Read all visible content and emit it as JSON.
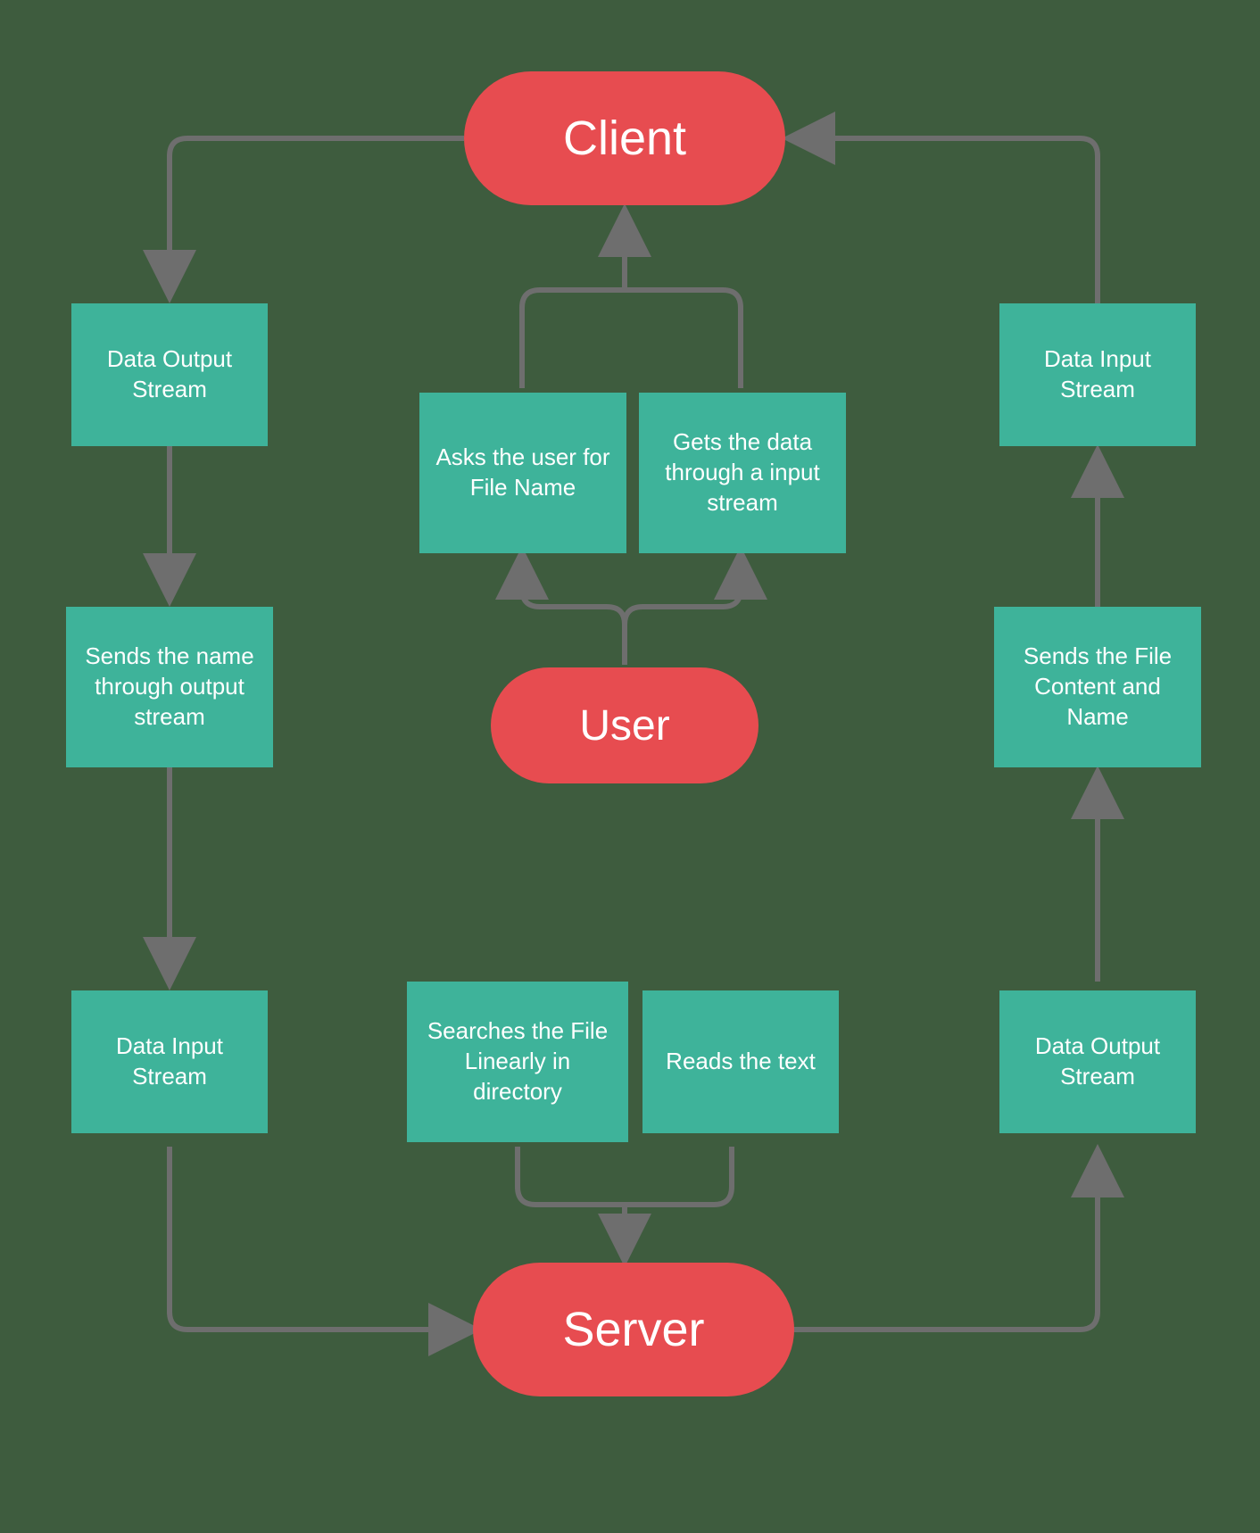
{
  "nodes": {
    "client": "Client",
    "user": "User",
    "server": "Server",
    "data_output_stream_left": "Data Output Stream",
    "sends_name": "Sends the name through output stream",
    "data_input_stream_left": "Data Input Stream",
    "asks_file_name": "Asks the user for File Name",
    "gets_data_input_stream": "Gets the data through a input stream",
    "searches_file": "Searches the File Linearly  in directory",
    "reads_text": "Reads the text",
    "data_input_stream_right": "Data Input Stream",
    "sends_file_content": "Sends the File Content and Name",
    "data_output_stream_right": "Data Output Stream"
  },
  "colors": {
    "pill": "#e74c50",
    "box": "#3eb39a",
    "wire": "#6e6e6e",
    "bg": "#3e5c3e"
  }
}
